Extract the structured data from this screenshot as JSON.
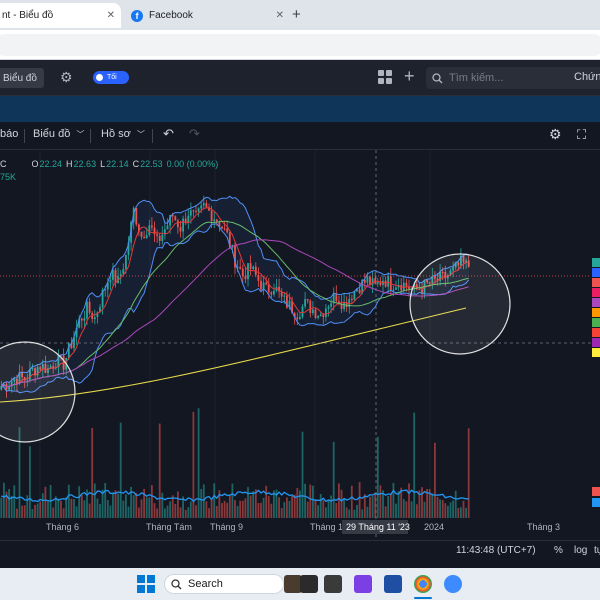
{
  "browser": {
    "tabs": [
      {
        "label": "nt - Biểu đồ",
        "close": "✕"
      },
      {
        "label": "Facebook",
        "close": "✕"
      }
    ],
    "new_tab": "+"
  },
  "topbar": {
    "chart_button": "Biểu đồ",
    "toggle_label": "Tối",
    "search_placeholder": "Tìm kiếm...",
    "right_label": "Chứn"
  },
  "toolbar": {
    "alerts": "báo",
    "chart_type": "Biểu đồ",
    "profile": "Hồ sơ"
  },
  "legend": {
    "symbol": "C",
    "o_label": "O",
    "o": "22.24",
    "h_label": "H",
    "h": "22.63",
    "l_label": "L",
    "l": "22.14",
    "c_label": "C",
    "c": "22.53",
    "change": "0.00 (0.00%)",
    "volume": "75K"
  },
  "colors": {
    "up": "#26a69a",
    "down": "#ef5350",
    "bollinger": "#4f8ff7",
    "ma_red": "#e53935",
    "ma_green": "#66bb6a",
    "ma_purple": "#ab47bc",
    "ma_yellow": "#e6d84a",
    "volume_line": "#2196f3"
  },
  "chart_data": {
    "type": "candlestick",
    "x_tick_labels": [
      "Tháng 6",
      "Tháng Tám",
      "Tháng 9",
      "Tháng 11",
      "2024",
      "Tháng 3"
    ],
    "crosshair_date": "29 Tháng 11 '23",
    "series": {
      "close": [
        17.0,
        17.2,
        17.5,
        17.4,
        17.9,
        18.2,
        18.0,
        18.5,
        18.3,
        19.5,
        20.8,
        21.5,
        21.0,
        22.4,
        23.6,
        23.1,
        24.6,
        27.3,
        25.8,
        26.5,
        25.4,
        26.2,
        27.0,
        26.3,
        27.2,
        26.8,
        27.5,
        27.1,
        26.6,
        25.8,
        24.4,
        23.5,
        23.9,
        23.2,
        22.6,
        22.9,
        22.1,
        21.7,
        21.3,
        21.8,
        21.5,
        21.2,
        21.9,
        22.3,
        21.8,
        22.4,
        22.9,
        23.2,
        22.8,
        23.3,
        23.0,
        23.1,
        22.9,
        22.6,
        22.8,
        23.0,
        23.2,
        23.4,
        23.7,
        24.2,
        24.0
      ]
    }
  },
  "time": {
    "clock": "11:43:48 (UTC+7)",
    "percent": "%",
    "log": "log",
    "auto": "tự"
  },
  "taskbar": {
    "search": "Search"
  }
}
